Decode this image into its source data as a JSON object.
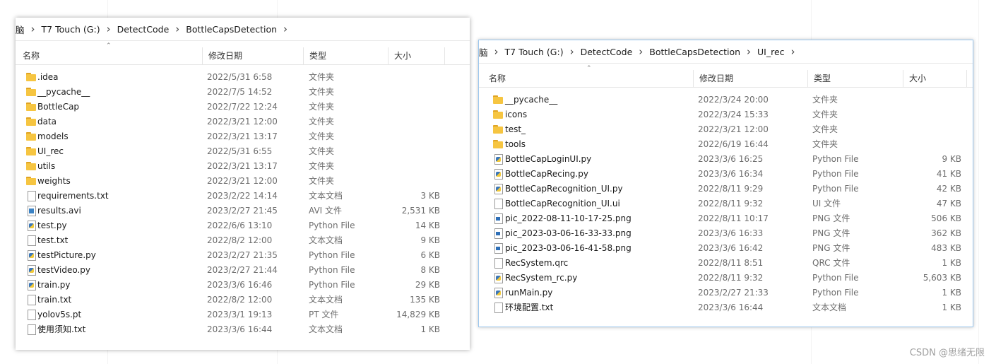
{
  "window1": {
    "breadcrumb": [
      "脑",
      "T7 Touch (G:)",
      "DetectCode",
      "BottleCapsDetection"
    ],
    "columns": {
      "name": "名称",
      "date": "修改日期",
      "type": "类型",
      "size": "大小"
    },
    "files": [
      {
        "icon": "folder-icon",
        "name": ".idea",
        "date": "2022/5/31 6:58",
        "type": "文件夹",
        "size": ""
      },
      {
        "icon": "folder-icon",
        "name": "__pycache__",
        "date": "2022/7/5 14:52",
        "type": "文件夹",
        "size": ""
      },
      {
        "icon": "folder-icon",
        "name": "BottleCap",
        "date": "2022/7/22 12:24",
        "type": "文件夹",
        "size": ""
      },
      {
        "icon": "folder-icon",
        "name": "data",
        "date": "2022/3/21 12:00",
        "type": "文件夹",
        "size": ""
      },
      {
        "icon": "folder-icon",
        "name": "models",
        "date": "2022/3/21 13:17",
        "type": "文件夹",
        "size": ""
      },
      {
        "icon": "folder-icon",
        "name": "UI_rec",
        "date": "2022/5/31 6:55",
        "type": "文件夹",
        "size": ""
      },
      {
        "icon": "folder-icon",
        "name": "utils",
        "date": "2022/3/21 13:17",
        "type": "文件夹",
        "size": ""
      },
      {
        "icon": "folder-icon",
        "name": "weights",
        "date": "2022/3/21 12:00",
        "type": "文件夹",
        "size": ""
      },
      {
        "icon": "text-file-icon",
        "name": "requirements.txt",
        "date": "2023/2/22 14:14",
        "type": "文本文档",
        "size": "3 KB"
      },
      {
        "icon": "video-file-icon",
        "name": "results.avi",
        "date": "2023/2/27 21:45",
        "type": "AVI 文件",
        "size": "2,531 KB"
      },
      {
        "icon": "python-file-icon",
        "name": "test.py",
        "date": "2022/6/6 13:10",
        "type": "Python File",
        "size": "14 KB"
      },
      {
        "icon": "text-file-icon",
        "name": "test.txt",
        "date": "2022/8/2 12:00",
        "type": "文本文档",
        "size": "9 KB"
      },
      {
        "icon": "python-file-icon",
        "name": "testPicture.py",
        "date": "2023/2/27 21:35",
        "type": "Python File",
        "size": "6 KB"
      },
      {
        "icon": "python-file-icon",
        "name": "testVideo.py",
        "date": "2023/2/27 21:44",
        "type": "Python File",
        "size": "8 KB"
      },
      {
        "icon": "python-file-icon",
        "name": "train.py",
        "date": "2023/3/6 16:46",
        "type": "Python File",
        "size": "29 KB"
      },
      {
        "icon": "text-file-icon",
        "name": "train.txt",
        "date": "2022/8/2 12:00",
        "type": "文本文档",
        "size": "135 KB"
      },
      {
        "icon": "file-icon",
        "name": "yolov5s.pt",
        "date": "2023/3/1 19:13",
        "type": "PT 文件",
        "size": "14,829 KB"
      },
      {
        "icon": "text-file-icon",
        "name": "使用须知.txt",
        "date": "2023/3/6 16:44",
        "type": "文本文档",
        "size": "1 KB"
      }
    ]
  },
  "window2": {
    "breadcrumb": [
      "脑",
      "T7 Touch (G:)",
      "DetectCode",
      "BottleCapsDetection",
      "UI_rec"
    ],
    "columns": {
      "name": "名称",
      "date": "修改日期",
      "type": "类型",
      "size": "大小"
    },
    "files": [
      {
        "icon": "folder-icon",
        "name": "__pycache__",
        "date": "2022/3/24 20:00",
        "type": "文件夹",
        "size": ""
      },
      {
        "icon": "folder-icon",
        "name": "icons",
        "date": "2022/3/24 15:33",
        "type": "文件夹",
        "size": ""
      },
      {
        "icon": "folder-icon",
        "name": "test_",
        "date": "2022/3/21 12:00",
        "type": "文件夹",
        "size": ""
      },
      {
        "icon": "folder-icon",
        "name": "tools",
        "date": "2022/6/19 16:44",
        "type": "文件夹",
        "size": ""
      },
      {
        "icon": "python-file-icon",
        "name": "BottleCapLoginUI.py",
        "date": "2023/3/6 16:25",
        "type": "Python File",
        "size": "9 KB"
      },
      {
        "icon": "python-file-icon",
        "name": "BottleCapRecing.py",
        "date": "2023/3/6 16:34",
        "type": "Python File",
        "size": "41 KB"
      },
      {
        "icon": "python-file-icon",
        "name": "BottleCapRecognition_UI.py",
        "date": "2022/8/11 9:29",
        "type": "Python File",
        "size": "42 KB"
      },
      {
        "icon": "file-icon",
        "name": "BottleCapRecognition_UI.ui",
        "date": "2022/8/11 9:32",
        "type": "UI 文件",
        "size": "47 KB"
      },
      {
        "icon": "image-file-icon",
        "name": "pic_2022-08-11-10-17-25.png",
        "date": "2022/8/11 10:17",
        "type": "PNG 文件",
        "size": "506 KB"
      },
      {
        "icon": "image-file-icon",
        "name": "pic_2023-03-06-16-33-33.png",
        "date": "2023/3/6 16:33",
        "type": "PNG 文件",
        "size": "362 KB"
      },
      {
        "icon": "image-file-icon",
        "name": "pic_2023-03-06-16-41-58.png",
        "date": "2023/3/6 16:42",
        "type": "PNG 文件",
        "size": "483 KB"
      },
      {
        "icon": "file-icon",
        "name": "RecSystem.qrc",
        "date": "2022/8/11 8:51",
        "type": "QRC 文件",
        "size": "1 KB"
      },
      {
        "icon": "python-file-icon",
        "name": "RecSystem_rc.py",
        "date": "2022/8/11 9:32",
        "type": "Python File",
        "size": "5,603 KB"
      },
      {
        "icon": "python-file-icon",
        "name": "runMain.py",
        "date": "2023/2/27 21:33",
        "type": "Python File",
        "size": "1 KB"
      },
      {
        "icon": "text-file-icon",
        "name": "环境配置.txt",
        "date": "2023/3/6 16:44",
        "type": "文本文档",
        "size": "1 KB"
      }
    ]
  },
  "watermark": "CSDN @思绪无限"
}
